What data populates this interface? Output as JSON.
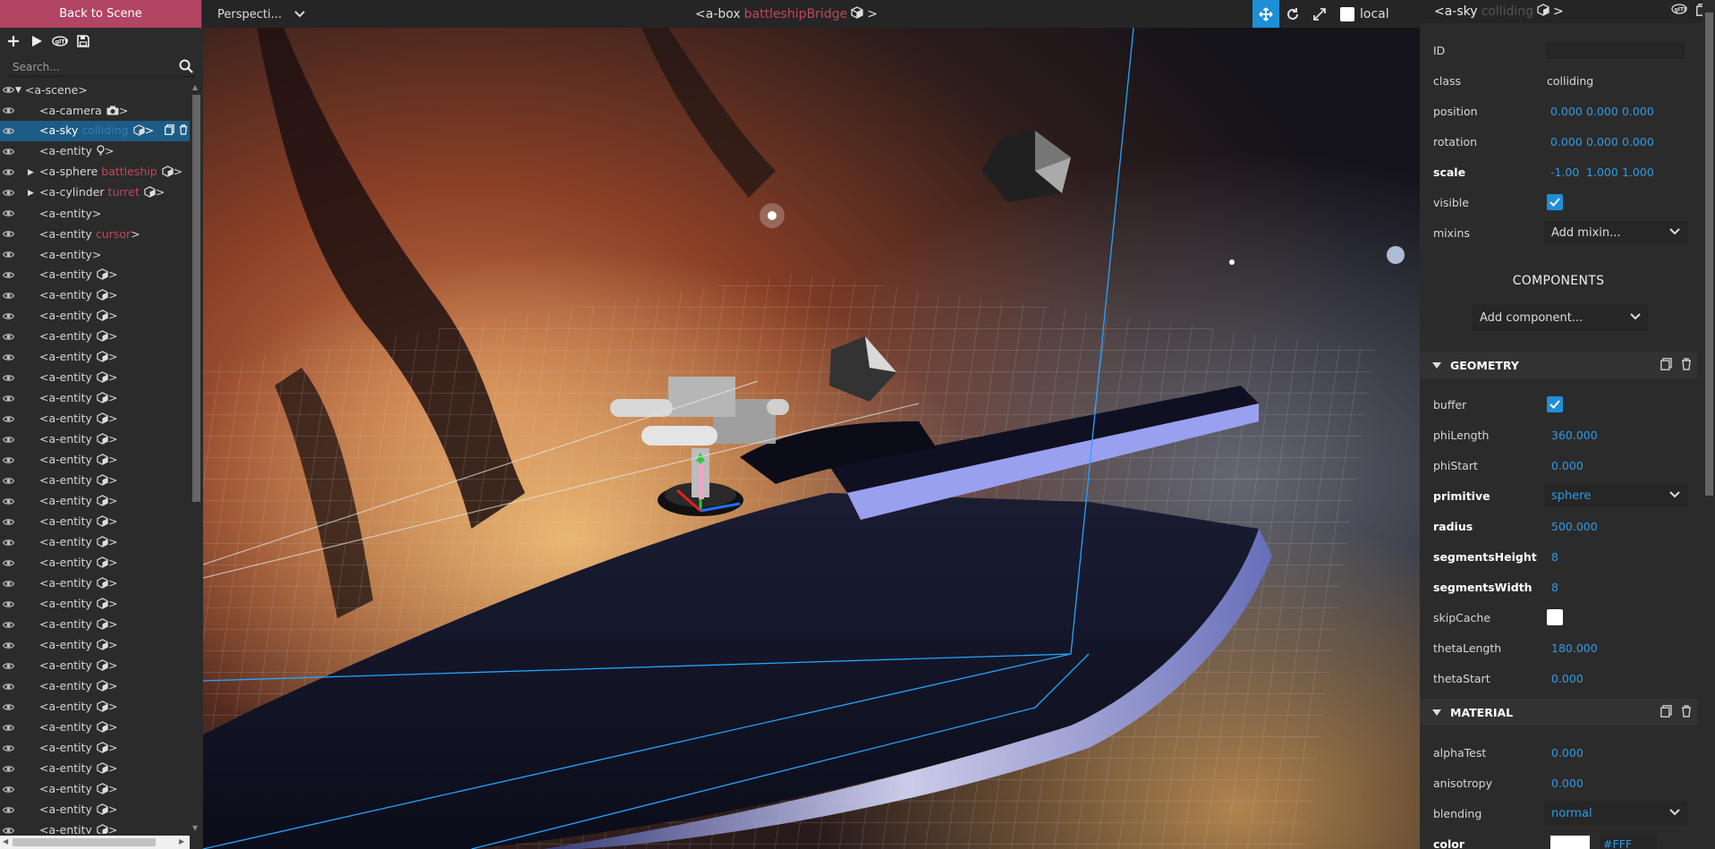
{
  "left": {
    "back_label": "Back to Scene",
    "search_placeholder": "Search...",
    "toolbar_icons": [
      "add-icon",
      "play-icon",
      "gltf-icon",
      "save-icon"
    ],
    "tree": [
      {
        "indent": 0,
        "tag": "<a-scene>",
        "cls": "",
        "expand": "open",
        "icon": "",
        "selected": false
      },
      {
        "indent": 1,
        "tag": "<a-camera",
        "cls": "",
        "expand": "",
        "icon": "camera",
        "selected": false
      },
      {
        "indent": 1,
        "tag": "<a-sky",
        "cls": "colliding",
        "expand": "",
        "icon": "cube",
        "selected": true
      },
      {
        "indent": 1,
        "tag": "<a-entity",
        "cls": "",
        "expand": "",
        "icon": "bulb",
        "selected": false
      },
      {
        "indent": 1,
        "tag": "<a-sphere",
        "cls": "battleship",
        "expand": "closed",
        "icon": "cube",
        "selected": false
      },
      {
        "indent": 1,
        "tag": "<a-cylinder",
        "cls": "turret",
        "expand": "closed",
        "icon": "cube",
        "selected": false
      },
      {
        "indent": 1,
        "tag": "<a-entity>",
        "cls": "",
        "expand": "",
        "icon": "",
        "selected": false
      },
      {
        "indent": 1,
        "tag": "<a-entity",
        "cls": "cursor",
        "expand": "",
        "icon": "",
        "selected": false
      },
      {
        "indent": 1,
        "tag": "<a-entity>",
        "cls": "",
        "expand": "",
        "icon": "",
        "selected": false
      },
      {
        "indent": 1,
        "tag": "<a-entity",
        "cls": "",
        "expand": "",
        "icon": "cube",
        "selected": false
      },
      {
        "indent": 1,
        "tag": "<a-entity",
        "cls": "",
        "expand": "",
        "icon": "cube",
        "selected": false
      },
      {
        "indent": 1,
        "tag": "<a-entity",
        "cls": "",
        "expand": "",
        "icon": "cube",
        "selected": false
      },
      {
        "indent": 1,
        "tag": "<a-entity",
        "cls": "",
        "expand": "",
        "icon": "cube",
        "selected": false
      },
      {
        "indent": 1,
        "tag": "<a-entity",
        "cls": "",
        "expand": "",
        "icon": "cube",
        "selected": false
      },
      {
        "indent": 1,
        "tag": "<a-entity",
        "cls": "",
        "expand": "",
        "icon": "cube",
        "selected": false
      },
      {
        "indent": 1,
        "tag": "<a-entity",
        "cls": "",
        "expand": "",
        "icon": "cube",
        "selected": false
      },
      {
        "indent": 1,
        "tag": "<a-entity",
        "cls": "",
        "expand": "",
        "icon": "cube",
        "selected": false
      },
      {
        "indent": 1,
        "tag": "<a-entity",
        "cls": "",
        "expand": "",
        "icon": "cube",
        "selected": false
      },
      {
        "indent": 1,
        "tag": "<a-entity",
        "cls": "",
        "expand": "",
        "icon": "cube",
        "selected": false
      },
      {
        "indent": 1,
        "tag": "<a-entity",
        "cls": "",
        "expand": "",
        "icon": "cube",
        "selected": false
      },
      {
        "indent": 1,
        "tag": "<a-entity",
        "cls": "",
        "expand": "",
        "icon": "cube",
        "selected": false
      },
      {
        "indent": 1,
        "tag": "<a-entity",
        "cls": "",
        "expand": "",
        "icon": "cube",
        "selected": false
      },
      {
        "indent": 1,
        "tag": "<a-entity",
        "cls": "",
        "expand": "",
        "icon": "cube",
        "selected": false
      },
      {
        "indent": 1,
        "tag": "<a-entity",
        "cls": "",
        "expand": "",
        "icon": "cube",
        "selected": false
      },
      {
        "indent": 1,
        "tag": "<a-entity",
        "cls": "",
        "expand": "",
        "icon": "cube",
        "selected": false
      },
      {
        "indent": 1,
        "tag": "<a-entity",
        "cls": "",
        "expand": "",
        "icon": "cube",
        "selected": false
      },
      {
        "indent": 1,
        "tag": "<a-entity",
        "cls": "",
        "expand": "",
        "icon": "cube",
        "selected": false
      },
      {
        "indent": 1,
        "tag": "<a-entity",
        "cls": "",
        "expand": "",
        "icon": "cube",
        "selected": false
      },
      {
        "indent": 1,
        "tag": "<a-entity",
        "cls": "",
        "expand": "",
        "icon": "cube",
        "selected": false
      },
      {
        "indent": 1,
        "tag": "<a-entity",
        "cls": "",
        "expand": "",
        "icon": "cube",
        "selected": false
      },
      {
        "indent": 1,
        "tag": "<a-entity",
        "cls": "",
        "expand": "",
        "icon": "cube",
        "selected": false
      },
      {
        "indent": 1,
        "tag": "<a-entity",
        "cls": "",
        "expand": "",
        "icon": "cube",
        "selected": false
      },
      {
        "indent": 1,
        "tag": "<a-entity",
        "cls": "",
        "expand": "",
        "icon": "cube",
        "selected": false
      },
      {
        "indent": 1,
        "tag": "<a-entity",
        "cls": "",
        "expand": "",
        "icon": "cube",
        "selected": false
      },
      {
        "indent": 1,
        "tag": "<a-entity",
        "cls": "",
        "expand": "",
        "icon": "cube",
        "selected": false
      },
      {
        "indent": 1,
        "tag": "<a-entity",
        "cls": "",
        "expand": "",
        "icon": "cube",
        "selected": false
      },
      {
        "indent": 1,
        "tag": "<a-entity",
        "cls": "",
        "expand": "",
        "icon": "cube",
        "selected": false
      }
    ]
  },
  "topbar": {
    "camera": "Perspecti...",
    "title_tag": "<a-box",
    "title_cls": "battleshipBridge",
    "title_end": ">",
    "local_label": "local"
  },
  "right": {
    "header_tag": "<a-sky",
    "header_cls": "colliding",
    "header_end": ">",
    "id_label": "ID",
    "class_label": "class",
    "class_value": "colliding",
    "position_label": "position",
    "position": [
      "0.000",
      "0.000",
      "0.000"
    ],
    "rotation_label": "rotation",
    "rotation": [
      "0.000",
      "0.000",
      "0.000"
    ],
    "scale_label": "scale",
    "scale": [
      "-1.00",
      "1.000",
      "1.000"
    ],
    "visible_label": "visible",
    "mixins_label": "mixins",
    "mixins_select": "Add mixin...",
    "components_title": "COMPONENTS",
    "add_component": "Add component...",
    "geometry_title": "GEOMETRY",
    "geometry": [
      {
        "label": "buffer",
        "type": "check",
        "checked": true,
        "bold": false
      },
      {
        "label": "phiLength",
        "type": "num",
        "value": "360.000",
        "bold": false
      },
      {
        "label": "phiStart",
        "type": "num",
        "value": "0.000",
        "bold": false
      },
      {
        "label": "primitive",
        "type": "select",
        "value": "sphere",
        "bold": true
      },
      {
        "label": "radius",
        "type": "num",
        "value": "500.000",
        "bold": true
      },
      {
        "label": "segmentsHeight",
        "type": "num",
        "value": "8",
        "bold": true
      },
      {
        "label": "segmentsWidth",
        "type": "num",
        "value": "8",
        "bold": true
      },
      {
        "label": "skipCache",
        "type": "check",
        "checked": false,
        "bold": false
      },
      {
        "label": "thetaLength",
        "type": "num",
        "value": "180.000",
        "bold": false
      },
      {
        "label": "thetaStart",
        "type": "num",
        "value": "0.000",
        "bold": false
      }
    ],
    "material_title": "MATERIAL",
    "material": [
      {
        "label": "alphaTest",
        "type": "num",
        "value": "0.000",
        "bold": false
      },
      {
        "label": "anisotropy",
        "type": "num",
        "value": "0.000",
        "bold": false
      },
      {
        "label": "blending",
        "type": "select",
        "value": "normal",
        "bold": false
      },
      {
        "label": "color",
        "type": "color",
        "value": "#FFF",
        "bold": true
      }
    ]
  },
  "colors": {
    "accent": "#1e8ed8",
    "back_button": "#b14562",
    "class_name": "#c5445f",
    "value_blue": "#2e9be6",
    "selection": "#1c5c86"
  }
}
